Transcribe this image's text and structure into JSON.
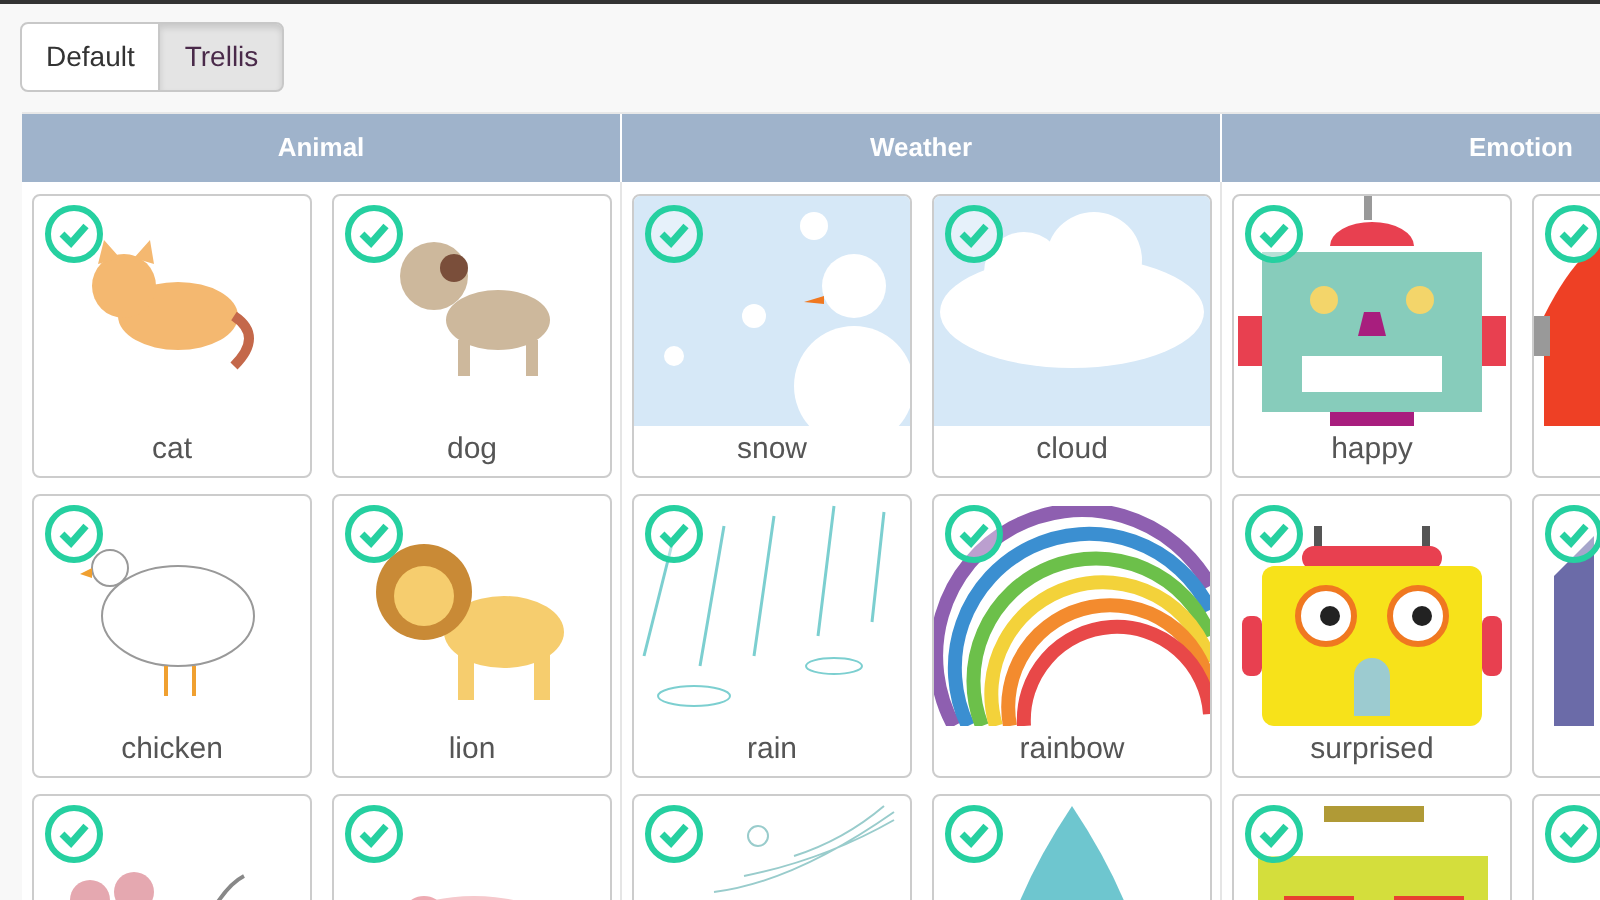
{
  "view_toggle": [
    {
      "label": "Default",
      "selected": false
    },
    {
      "label": "Trellis",
      "selected": true
    }
  ],
  "categories": [
    {
      "name": "Animal",
      "items": [
        {
          "label": "cat",
          "checked": true
        },
        {
          "label": "dog",
          "checked": true
        },
        {
          "label": "chicken",
          "checked": true
        },
        {
          "label": "lion",
          "checked": true
        },
        {
          "checked": true
        },
        {
          "checked": true
        }
      ]
    },
    {
      "name": "Weather",
      "items": [
        {
          "label": "snow",
          "checked": true
        },
        {
          "label": "cloud",
          "checked": true
        },
        {
          "label": "rain",
          "checked": true
        },
        {
          "label": "rainbow",
          "checked": true
        },
        {
          "checked": true
        },
        {
          "checked": true
        }
      ]
    },
    {
      "name": "Emotion",
      "items": [
        {
          "label": "happy",
          "checked": true
        },
        {
          "checked": true
        },
        {
          "label": "surprised",
          "checked": true
        },
        {
          "checked": true
        },
        {
          "checked": true
        },
        {
          "checked": true
        }
      ]
    }
  ]
}
